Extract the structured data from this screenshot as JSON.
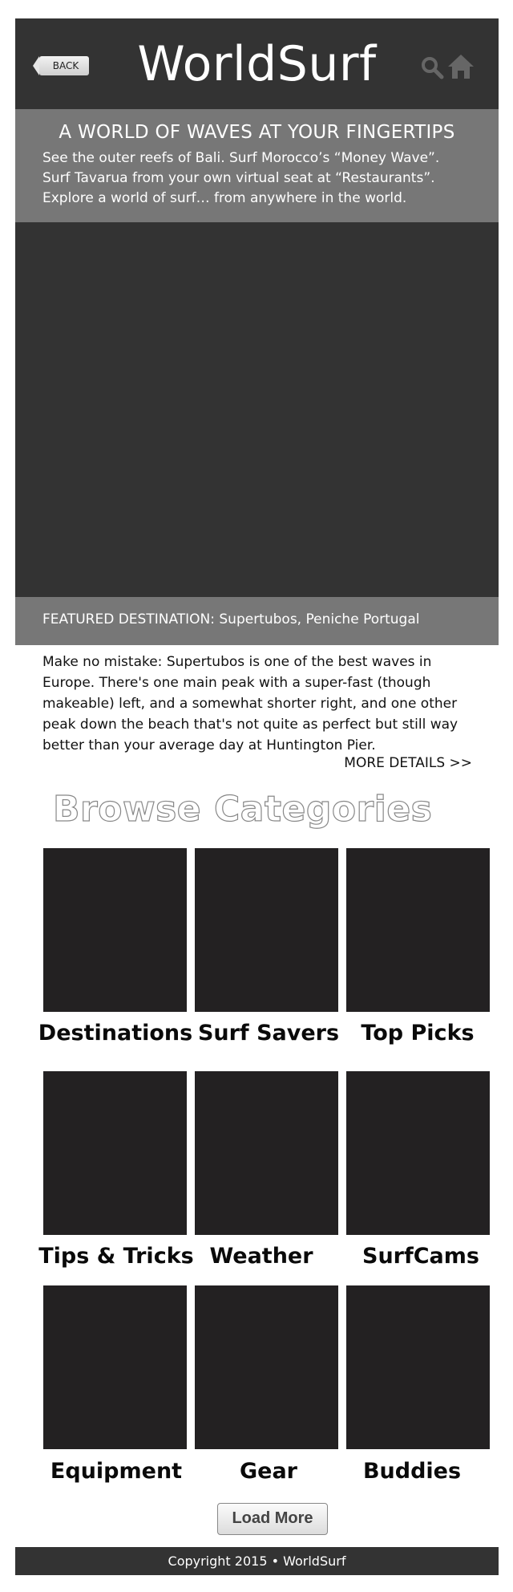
{
  "header": {
    "back_label": "BACK",
    "logo": "WorldSurf",
    "icons": [
      "search-icon",
      "home-icon"
    ],
    "icon_color": "#666666"
  },
  "intro": {
    "headline": "A WORLD OF WAVES AT YOUR FINGERTIPS",
    "body": "See the outer reefs of Bali. Surf Morocco’s “Money Wave”. Surf Tavarua from your own virtual seat at “Restaurants”. Explore a world of surf… from anywhere in the world."
  },
  "featured": {
    "label": "FEATURED DESTINATION: Supertubos, Peniche Portugal",
    "description": "Make no mistake: Supertubos is one of the best waves in Europe. There's one main peak with a super-fast (though makeable) left, and a somewhat shorter right, and one other peak down the beach that's not quite as perfect but still way better than your average day at Huntington Pier.",
    "more_link": "MORE DETAILS >>"
  },
  "browse": {
    "title": "Browse Categories",
    "categories": [
      {
        "label": "Destinations"
      },
      {
        "label": "Surf Savers"
      },
      {
        "label": "Top Picks"
      },
      {
        "label": "Tips & Tricks"
      },
      {
        "label": "Weather"
      },
      {
        "label": "SurfCams"
      },
      {
        "label": "Equipment"
      },
      {
        "label": "Gear"
      },
      {
        "label": "Buddies"
      }
    ],
    "load_more": "Load More"
  },
  "footer": {
    "copyright": "Copyright 2015 • WorldSurf"
  },
  "colors": {
    "dark_panel": "#333333",
    "mid_panel": "#777777",
    "tile": "#232122"
  }
}
